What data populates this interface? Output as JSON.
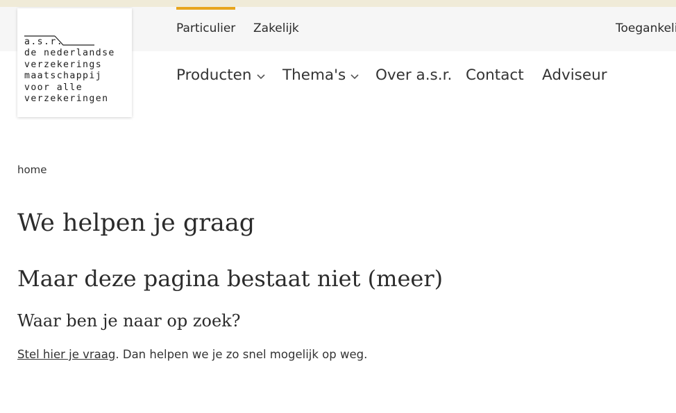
{
  "logo": {
    "lines": [
      "a.s.r.",
      "de nederlandse",
      "verzekerings",
      "maatschappij",
      "voor alle",
      "verzekeringen"
    ]
  },
  "subnav": {
    "particulier": "Particulier",
    "zakelijk": "Zakelijk",
    "toegankelijkheid": "Toegankelij"
  },
  "mainnav": {
    "producten": "Producten",
    "themas": "Thema's",
    "over": "Over a.s.r.",
    "contact": "Contact",
    "adviseur": "Adviseur"
  },
  "breadcrumb": "home",
  "content": {
    "h1": "We helpen je graag",
    "h2": "Maar deze pagina bestaat niet (meer)",
    "h3": "Waar ben je naar op zoek?",
    "link": "Stel hier je vraag",
    "rest": ". Dan helpen we je zo snel mogelijk op weg."
  },
  "colors": {
    "accent": "#e8a51d",
    "top_strip": "#f0ebd8",
    "subnav_bg": "#f6f6f6"
  },
  "icons": {
    "chevron": "chevron-down-icon"
  }
}
